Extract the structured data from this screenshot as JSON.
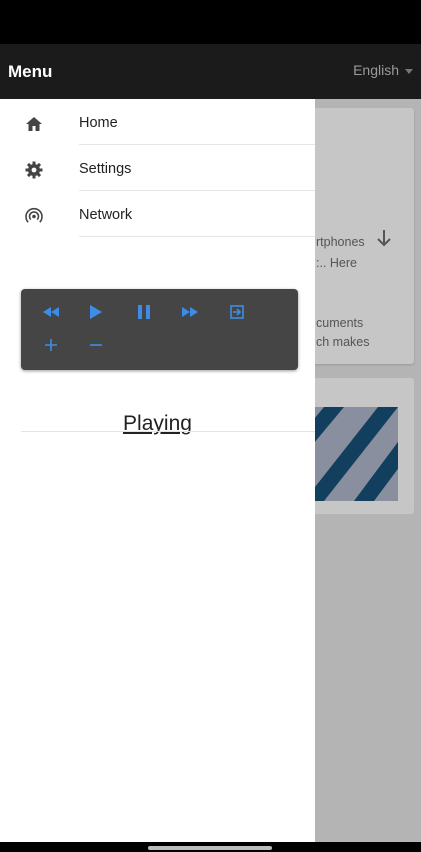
{
  "drawer": {
    "title": "Menu",
    "items": [
      {
        "label": "Home",
        "icon": "home-icon"
      },
      {
        "label": "Settings",
        "icon": "gear-icon"
      },
      {
        "label": "Network",
        "icon": "network-icon"
      }
    ]
  },
  "topbar": {
    "language": "English"
  },
  "player": {
    "controls": [
      "rewind-icon",
      "play-icon",
      "pause-icon",
      "fast-forward-icon",
      "exit-icon",
      "plus-icon",
      "minus-icon"
    ],
    "accent": "#3d8de8"
  },
  "status_text": "Playing",
  "background": {
    "card1_lines": [
      "rtphones",
      ":.. Here",
      "cuments",
      "ch makes"
    ]
  }
}
